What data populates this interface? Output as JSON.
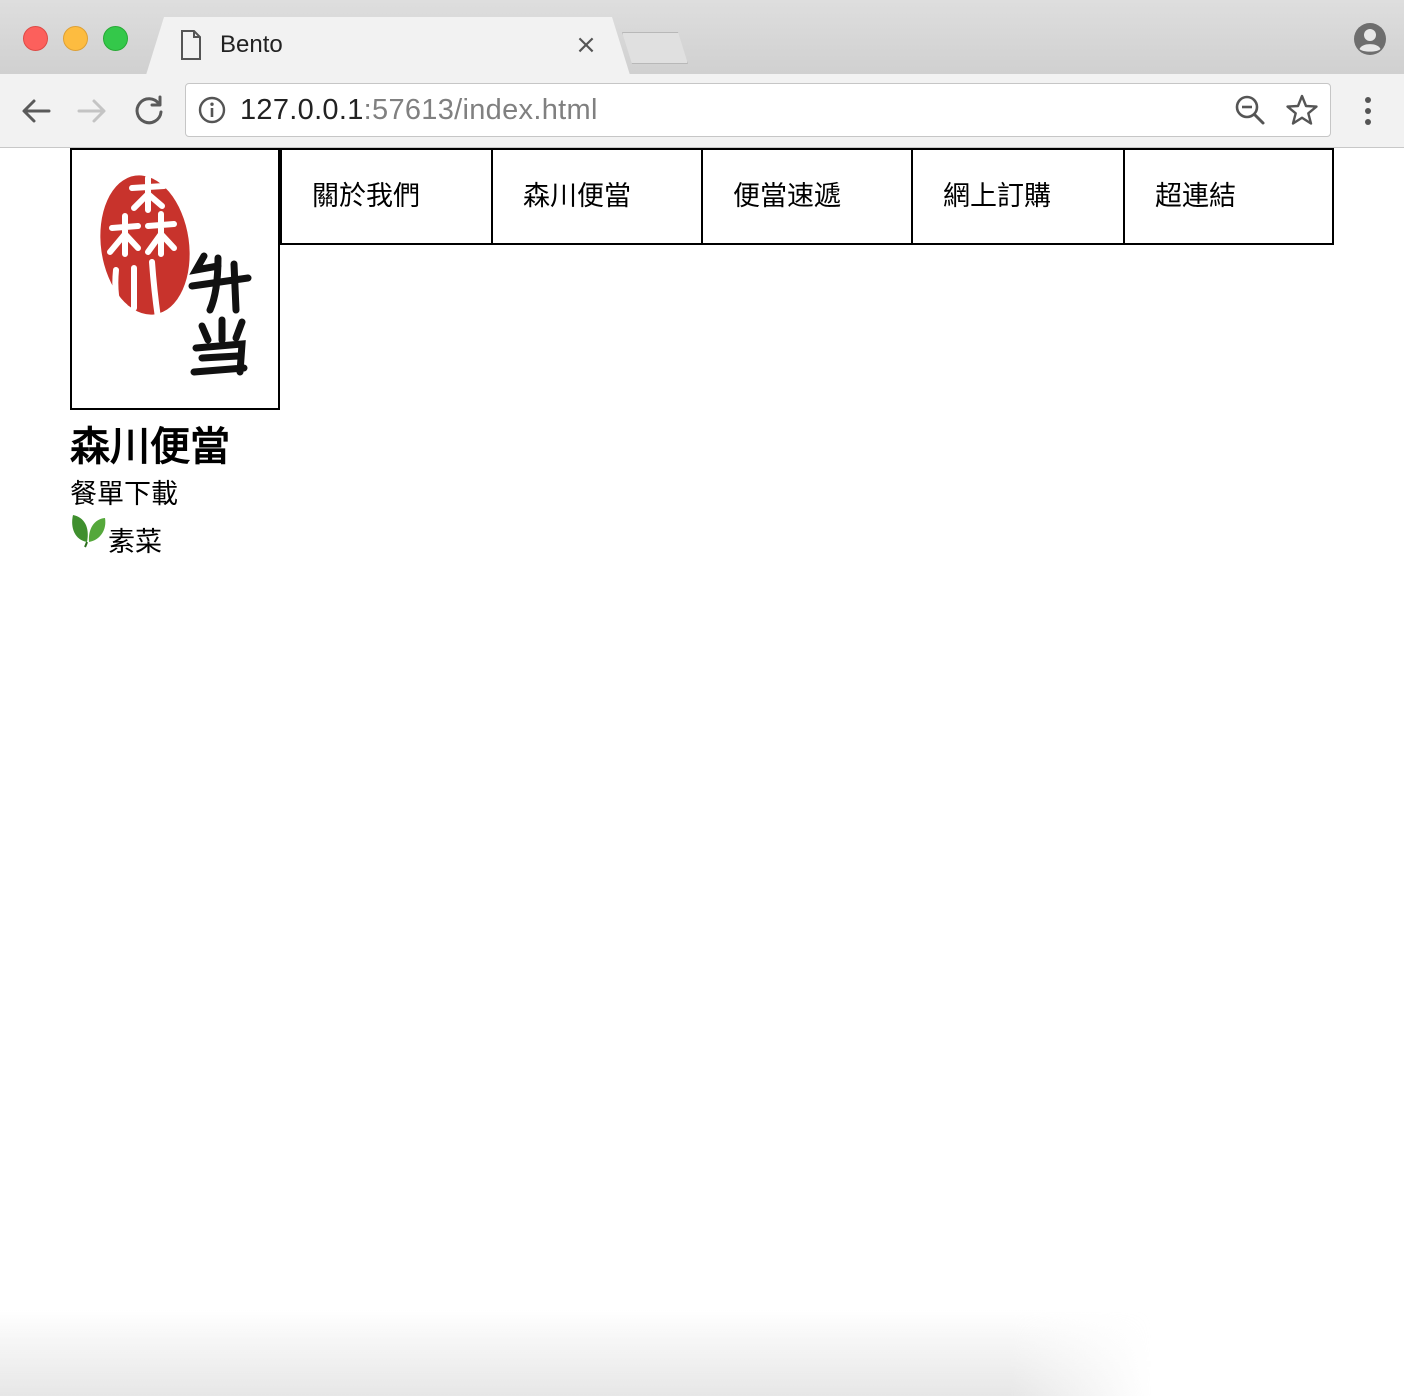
{
  "browser": {
    "tab_title": "Bento",
    "url_host": "127.0.0.1",
    "url_rest": ":57613/index.html"
  },
  "page": {
    "nav": [
      "關於我們",
      "森川便當",
      "便當速遞",
      "網上訂購",
      "超連結"
    ],
    "brand_title": "森川便當",
    "menu_download": "餐單下載",
    "vegetarian_label": "素菜",
    "logo": {
      "seal_color": "#c8332c",
      "seal_text": "森川",
      "side_text": "弁当"
    }
  }
}
